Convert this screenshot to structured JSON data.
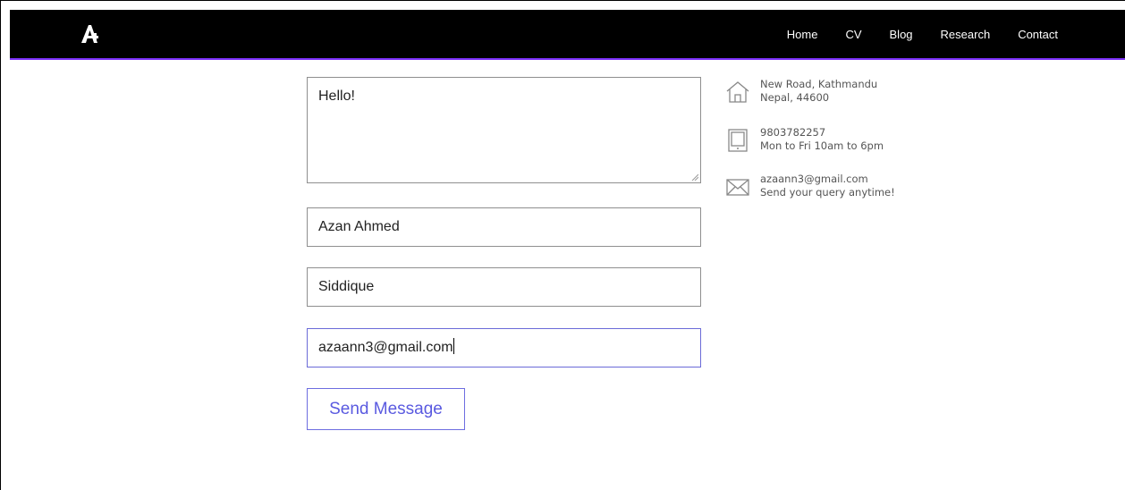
{
  "nav": {
    "logo_icon": "logo-a-icon",
    "links": [
      "Home",
      "CV",
      "Blog",
      "Research",
      "Contact"
    ]
  },
  "form": {
    "message": "Hello!",
    "first_name": "Azan Ahmed",
    "last_name": "Siddique",
    "email": "azaann3@gmail.com",
    "submit_label": "Send Message"
  },
  "contact_info": [
    {
      "icon": "home-icon",
      "line1": "New Road, Kathmandu",
      "line2": "Nepal, 44600"
    },
    {
      "icon": "tablet-icon",
      "line1": "9803782257",
      "line2": "Mon to Fri 10am to 6pm"
    },
    {
      "icon": "envelope-icon",
      "line1": "azaann3@gmail.com",
      "line2": "Send your query anytime!"
    }
  ],
  "colors": {
    "navbar": "#000000",
    "accent": "#7b2ff7",
    "button_text": "#5a5ae0"
  }
}
